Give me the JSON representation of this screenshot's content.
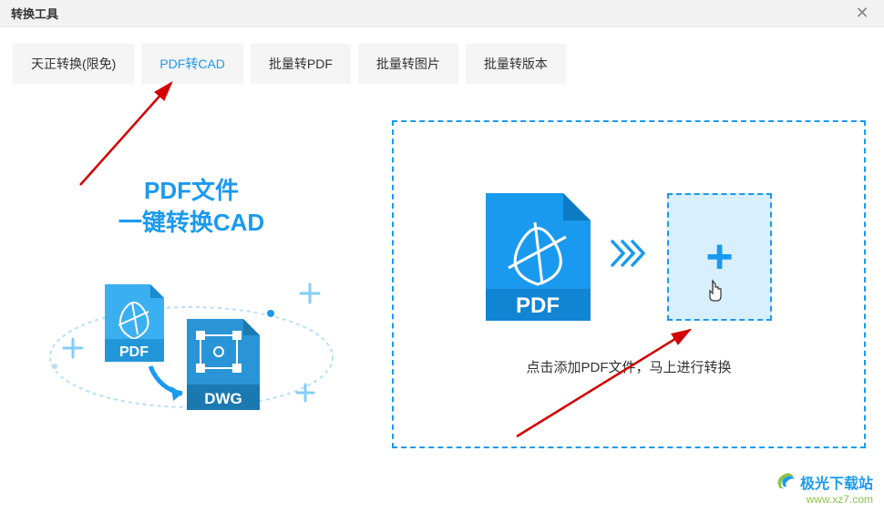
{
  "titlebar": {
    "title": "转换工具",
    "close": "✕"
  },
  "tabs": [
    {
      "label": "天正转换(限免)",
      "active": false
    },
    {
      "label": "PDF转CAD",
      "active": true
    },
    {
      "label": "批量转PDF",
      "active": false
    },
    {
      "label": "批量转图片",
      "active": false
    },
    {
      "label": "批量转版本",
      "active": false
    }
  ],
  "promo": {
    "line1": "PDF文件",
    "line2": "一键转换CAD",
    "pdf_label": "PDF",
    "dwg_label": "DWG"
  },
  "drop": {
    "pdf_label": "PDF",
    "chevrons": "»",
    "plus": "+",
    "text": "点击添加PDF文件，马上进行转换"
  },
  "watermark": {
    "brand": "极光下载站",
    "url": "www.xz7.com"
  }
}
